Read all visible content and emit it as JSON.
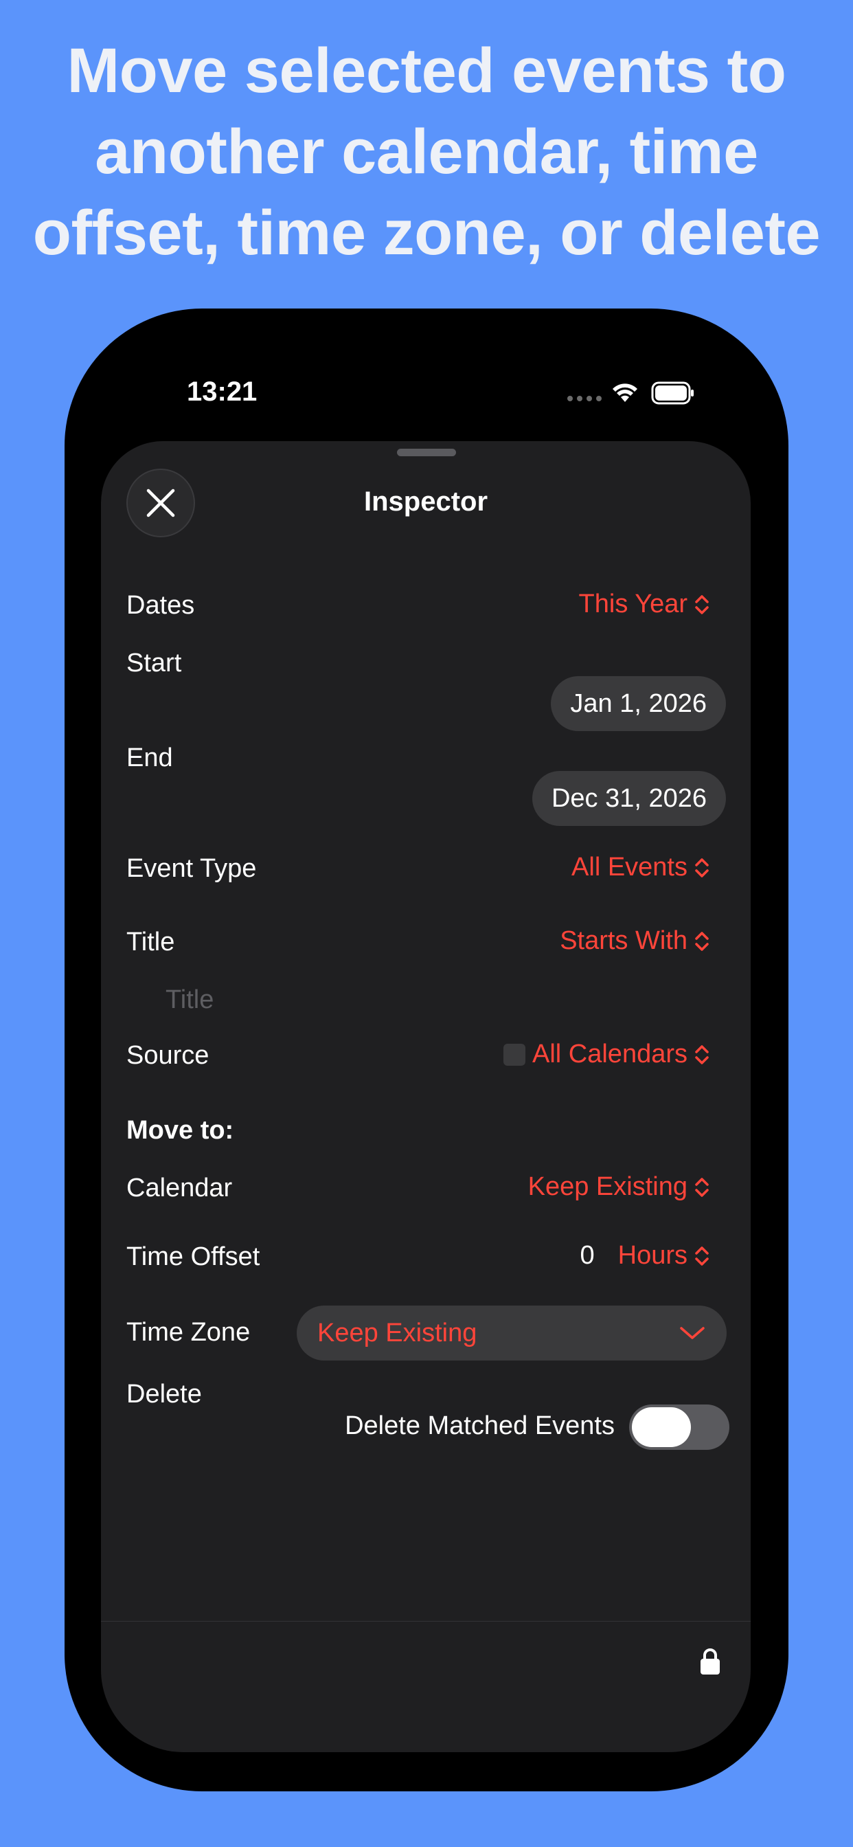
{
  "headline": {
    "lines": [
      "Move selected events to",
      "another calendar, time",
      "offset, time zone, or delete"
    ]
  },
  "status_bar": {
    "time": "13:21"
  },
  "sheet": {
    "title": "Inspector",
    "dates": {
      "label": "Dates",
      "value": "This Year"
    },
    "start": {
      "label": "Start",
      "value": "Jan 1, 2026"
    },
    "end": {
      "label": "End",
      "value": "Dec 31, 2026"
    },
    "event_type": {
      "label": "Event Type",
      "value": "All Events"
    },
    "title_row": {
      "label": "Title",
      "value": "Starts With",
      "placeholder": "Title"
    },
    "source": {
      "label": "Source",
      "value": "All Calendars"
    },
    "move_to": {
      "heading": "Move to:"
    },
    "calendar": {
      "label": "Calendar",
      "value": "Keep Existing"
    },
    "time_offset": {
      "label": "Time Offset",
      "amount": "0",
      "unit": "Hours"
    },
    "time_zone": {
      "label": "Time Zone",
      "value": "Keep Existing"
    },
    "delete": {
      "label": "Delete",
      "toggle_label": "Delete Matched Events",
      "toggle_on": false
    }
  },
  "colors": {
    "background": "#5b94fb",
    "accent": "#ff453a",
    "sheet": "#1f1f21"
  },
  "icons": [
    "close-icon",
    "wifi-icon",
    "battery-icon",
    "chevron-updown-icon",
    "chevron-down-icon",
    "lock-icon"
  ]
}
